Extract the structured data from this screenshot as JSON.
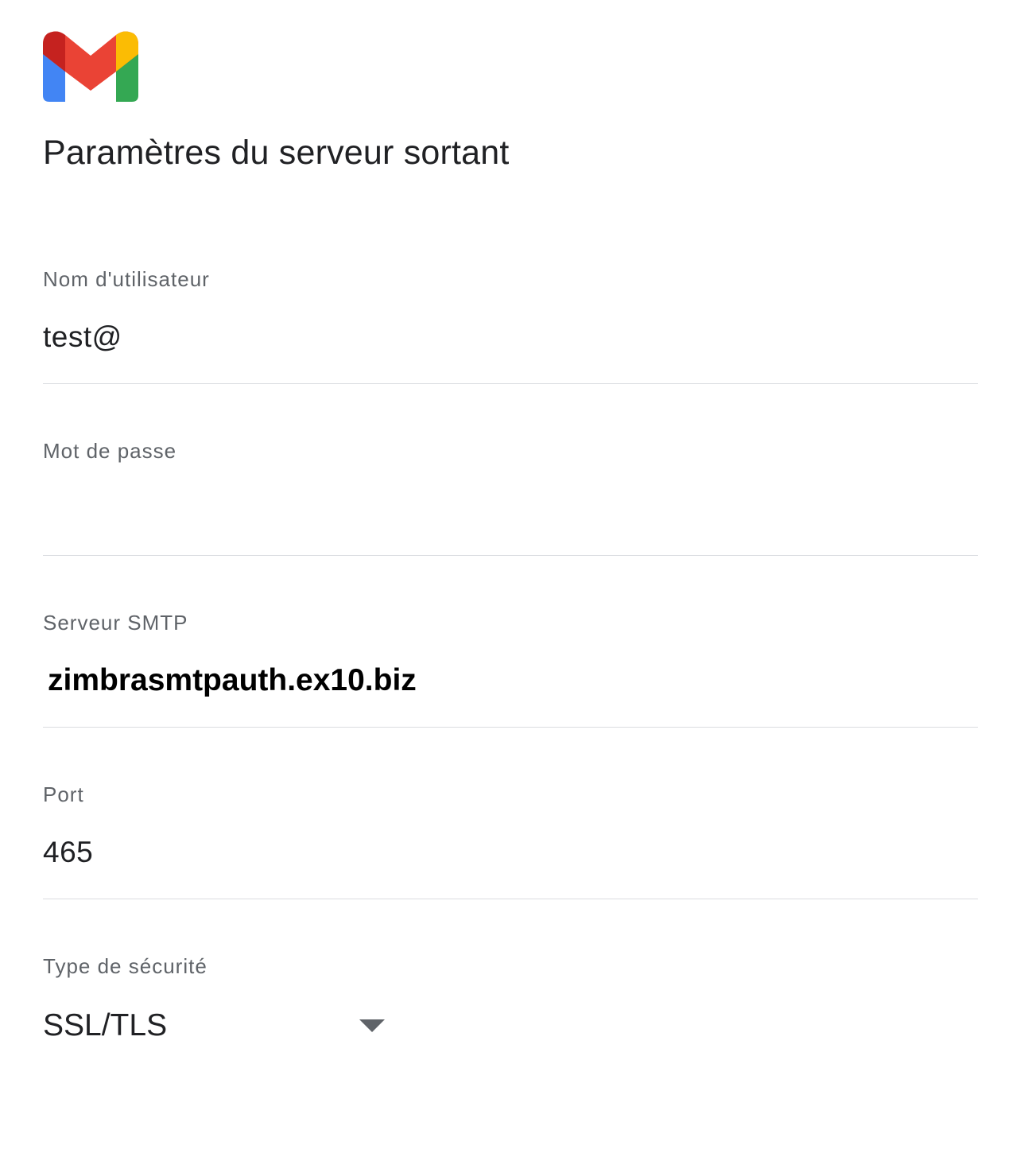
{
  "app": {
    "logo_icon": "gmail-logo-icon",
    "brand_colors": {
      "red": "#EA4335",
      "dark_red": "#C5221F",
      "blue": "#4285F4",
      "green": "#34A853",
      "yellow": "#FBBC04"
    }
  },
  "page": {
    "title": "Paramètres du serveur sortant"
  },
  "form": {
    "username": {
      "label": "Nom d'utilisateur",
      "value": "test@"
    },
    "password": {
      "label": "Mot de passe",
      "value": ""
    },
    "smtp_server": {
      "label": "Serveur SMTP",
      "value": "zimbrasmtpauth.ex10.biz"
    },
    "port": {
      "label": "Port",
      "value": "465"
    },
    "security_type": {
      "label": "Type de sécurité",
      "selected": "SSL/TLS",
      "dropdown_icon": "caret-down-icon"
    }
  }
}
